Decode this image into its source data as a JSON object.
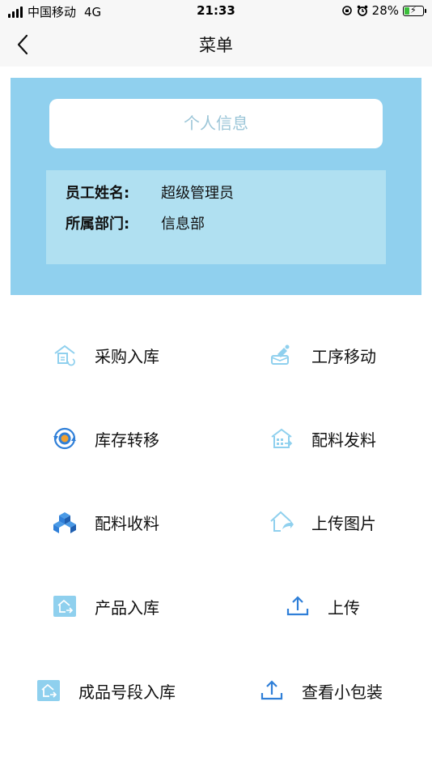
{
  "status_bar": {
    "carrier": "中国移动",
    "network": "4G",
    "time": "21:33",
    "battery_percent": "28%"
  },
  "nav": {
    "title": "菜单"
  },
  "info": {
    "header": "个人信息",
    "rows": [
      {
        "label": "员工姓名:",
        "value": "超级管理员"
      },
      {
        "label": "所属部门:",
        "value": "信息部"
      }
    ]
  },
  "menu": {
    "items": [
      {
        "label": "采购入库",
        "icon": "warehouse-in-icon"
      },
      {
        "label": "工序移动",
        "icon": "process-move-icon"
      },
      {
        "label": "库存转移",
        "icon": "inventory-transfer-icon"
      },
      {
        "label": "配料发料",
        "icon": "material-issue-icon"
      },
      {
        "label": "配料收料",
        "icon": "material-receive-icon"
      },
      {
        "label": "上传图片",
        "icon": "upload-image-icon"
      },
      {
        "label": "产品入库",
        "icon": "product-in-icon"
      },
      {
        "label": "上传",
        "icon": "upload-icon"
      },
      {
        "label": "成品号段入库",
        "icon": "product-segment-in-icon"
      },
      {
        "label": "查看小包装",
        "icon": "upload-icon"
      }
    ]
  },
  "colors": {
    "panel": "#90d0ee",
    "info_box": "#b0e0f1",
    "icon_light": "#8fd0ee",
    "icon_blue": "#2f7fd8"
  }
}
